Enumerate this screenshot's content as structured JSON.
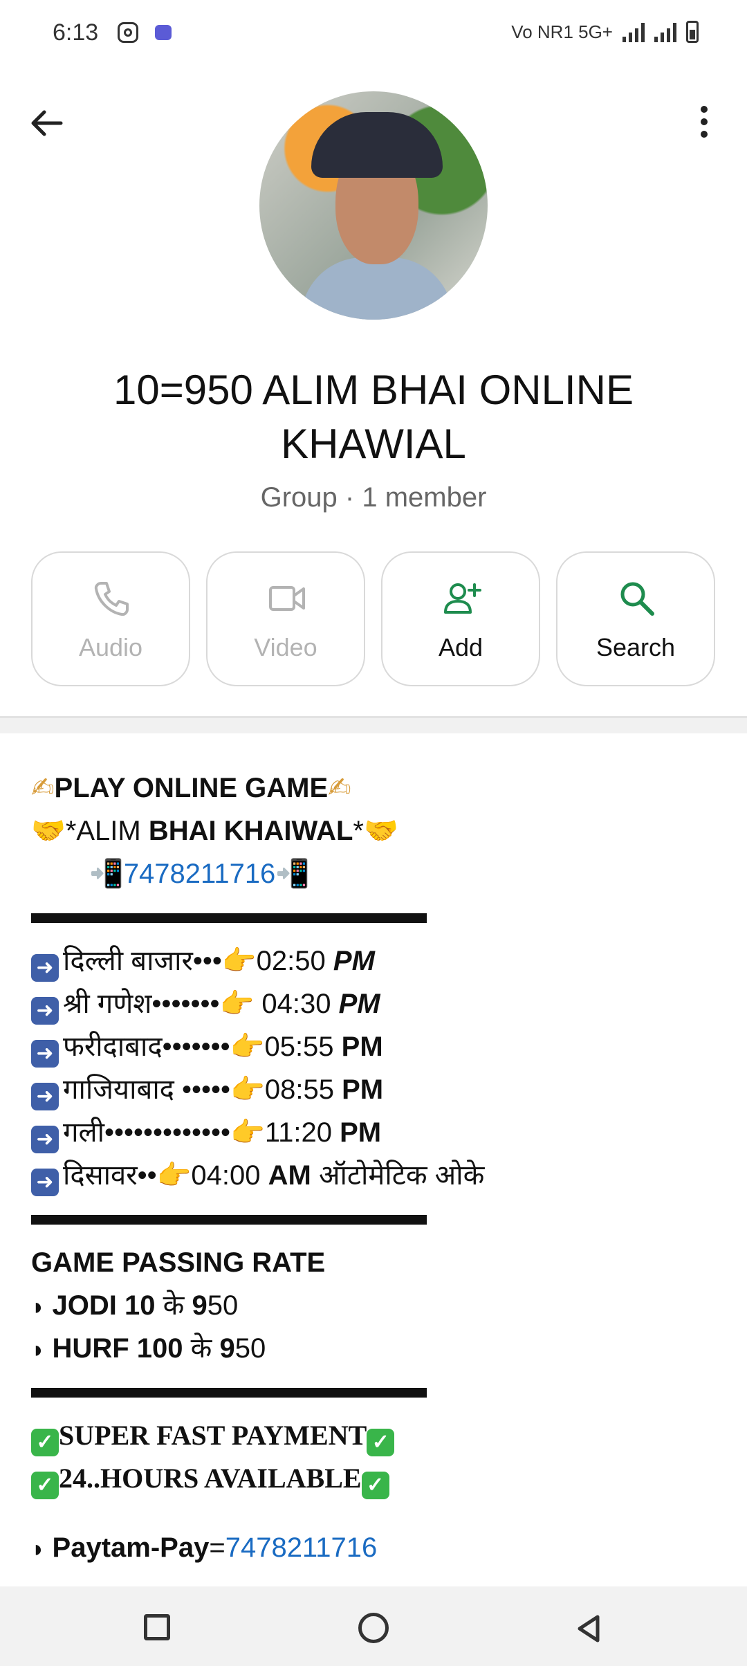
{
  "status_bar": {
    "time": "6:13",
    "network": "Vo NR1 5G+"
  },
  "header": {
    "back_icon": "arrow-left-icon",
    "menu_icon": "more-vertical-icon"
  },
  "profile": {
    "title": "10=950 ALIM BHAI ONLINE KHAWIAL",
    "subtitle": "Group · 1 member"
  },
  "actions": [
    {
      "label": "Audio",
      "icon": "phone-icon",
      "enabled": false
    },
    {
      "label": "Video",
      "icon": "video-icon",
      "enabled": false
    },
    {
      "label": "Add",
      "icon": "add-person-icon",
      "enabled": true
    },
    {
      "label": "Search",
      "icon": "search-icon",
      "enabled": true
    }
  ],
  "description": {
    "heading": "PLAY ONLINE GAME",
    "name_prefix": "*ALIM ",
    "name_bold": "BHAI KHAIWAL",
    "name_suffix": "*",
    "phone": "7478211716",
    "schedule": [
      {
        "place": "दिल्ली बाजार•••",
        "time": "02:50 ",
        "ampm": "PM"
      },
      {
        "place": "श्री गणेश•••••••",
        "time": " 04:30 ",
        "ampm": "PM"
      },
      {
        "place": "फरीदाबाद•••••••",
        "time": "05:55 ",
        "ampm": "PM"
      },
      {
        "place": "गाजियाबाद •••••",
        "time": "08:55 ",
        "ampm": "PM"
      },
      {
        "place": "गली•••••••••••••",
        "time": "11:20 ",
        "ampm": "PM"
      },
      {
        "place": "दिसावर••",
        "time": "04:00 ",
        "ampm": "AM",
        "extra": " ऑटोमेटिक ओके"
      }
    ],
    "rate_heading": "GAME PASSING RATE",
    "rate_lines": [
      {
        "bold": "JODI 10",
        "mid": " के ",
        "bold2": "9",
        "end": "50"
      },
      {
        "bold": "HURF 100",
        "mid": " के ",
        "bold2": "9",
        "end": "50"
      }
    ],
    "payment_line": "SUPER FAST PAYMENT",
    "hours_line": "24..HOURS AVAILABLE",
    "paytm_label": "Paytam-Pay",
    "paytm_equals": "=",
    "paytm_number": "7478211716"
  },
  "colors": {
    "accent_green": "#1e8c4e",
    "link_blue": "#1a6bc2",
    "disabled_gray": "#b3b3b3"
  }
}
